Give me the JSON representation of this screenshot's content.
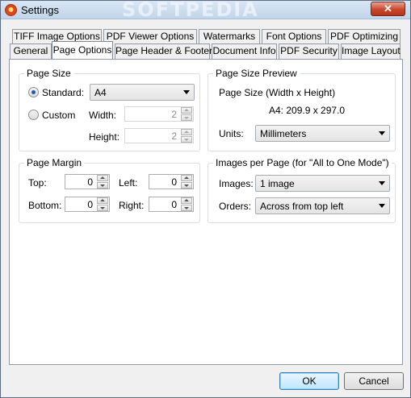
{
  "window": {
    "title": "Settings",
    "watermark": "SOFTPEDIA",
    "close_glyph": "✕"
  },
  "tabs_back": [
    "TIFF Image Options",
    "PDF Viewer Options",
    "Watermarks",
    "Font Options",
    "PDF Optimizing"
  ],
  "tabs_front": [
    "General",
    "Page Options",
    "Page Header & Footer",
    "Document Info",
    "PDF Security",
    "Image Layout"
  ],
  "active_tab": "Page Options",
  "page_size": {
    "title": "Page Size",
    "standard_label": "Standard:",
    "standard_value": "A4",
    "custom_label": "Custom",
    "width_label": "Width:",
    "width_value": "2",
    "height_label": "Height:",
    "height_value": "2",
    "selected": "standard"
  },
  "preview": {
    "title": "Page Size Preview",
    "caption": "Page Size (Width x Height)",
    "value": "A4: 209.9 x 297.0",
    "units_label": "Units:",
    "units_value": "Millimeters"
  },
  "margin": {
    "title": "Page Margin",
    "top_label": "Top:",
    "top_value": "0",
    "left_label": "Left:",
    "left_value": "0",
    "bottom_label": "Bottom:",
    "bottom_value": "0",
    "right_label": "Right:",
    "right_value": "0"
  },
  "images": {
    "title": "Images per Page (for \"All to One Mode\")",
    "images_label": "Images:",
    "images_value": "1 image",
    "orders_label": "Orders:",
    "orders_value": "Across from top left"
  },
  "buttons": {
    "ok": "OK",
    "cancel": "Cancel"
  }
}
